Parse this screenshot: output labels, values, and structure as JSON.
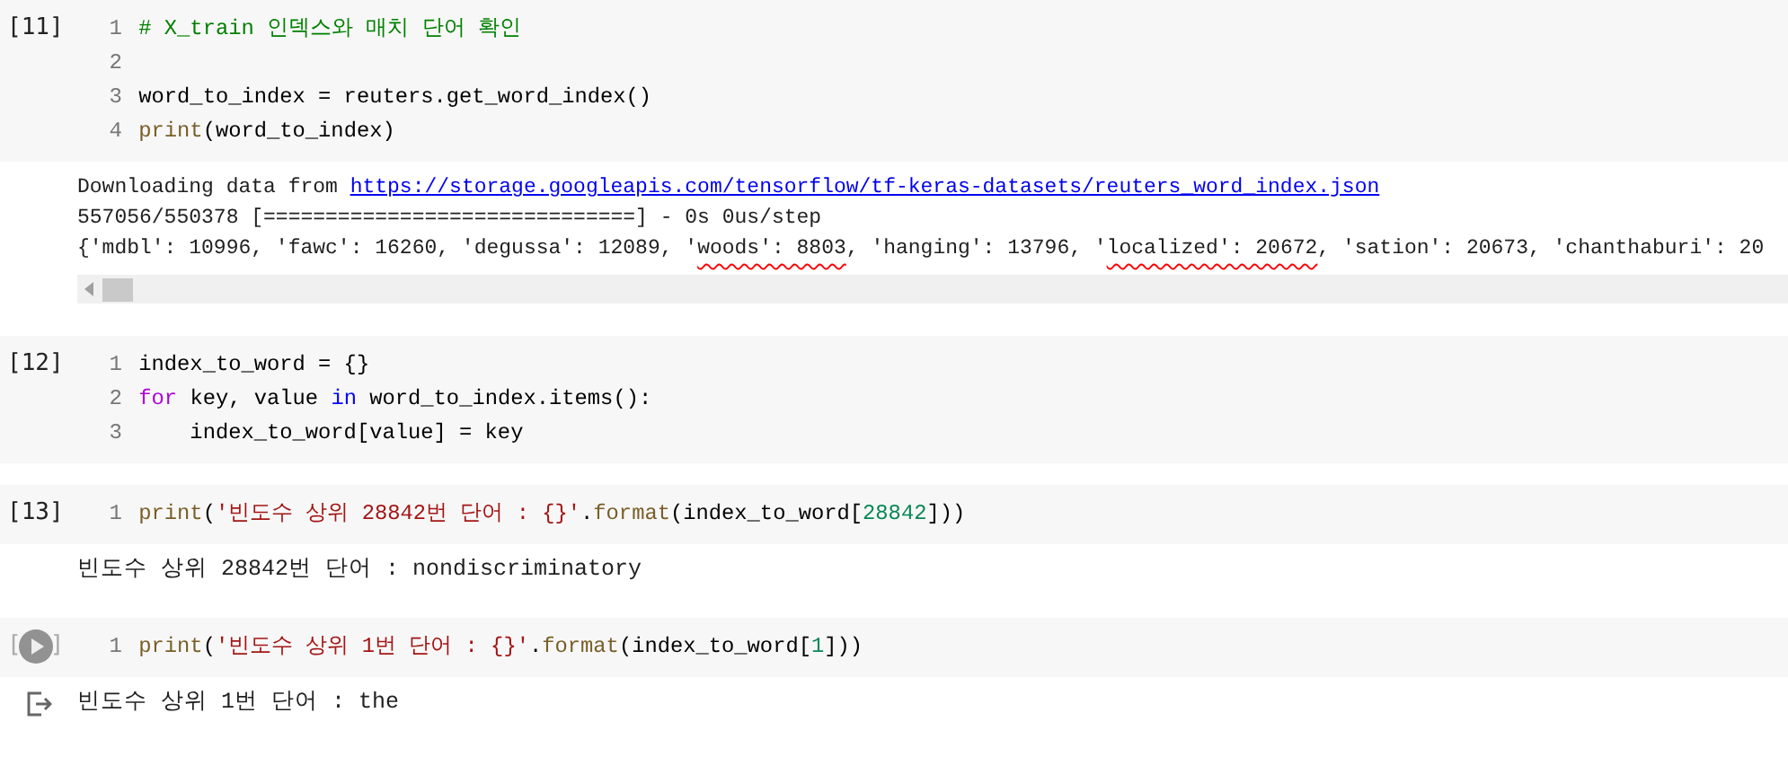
{
  "cells": [
    {
      "count": "[11]",
      "run_button": false,
      "lines": [
        {
          "no": "1",
          "tokens": [
            {
              "kind": "comment",
              "text": "# X_train 인덱스와 매치 단어 확인"
            }
          ]
        },
        {
          "no": "2"
        },
        {
          "no": "3",
          "tokens": [
            {
              "kind": "plain",
              "text": "word_to_index = reuters.get_word_index()"
            }
          ]
        },
        {
          "no": "4",
          "tokens": [
            {
              "kind": "builtin",
              "text": "print"
            },
            {
              "kind": "plain",
              "text": "(word_to_index)"
            }
          ]
        }
      ],
      "output": {
        "kind": "plain",
        "scrollbar": true,
        "lines": [
          [
            {
              "kind": "plain",
              "text": "Downloading data from "
            },
            {
              "kind": "link",
              "text": "https://storage.googleapis.com/tensorflow/tf-keras-datasets/reuters_word_index.json"
            }
          ],
          [
            {
              "kind": "plain",
              "text": "557056/550378 [==============================] - 0s 0us/step"
            }
          ],
          [
            {
              "kind": "plain",
              "text": "{'mdbl': 10996, 'fawc': 16260, 'degussa': 12089, '"
            },
            {
              "kind": "marked",
              "text": "woods': 8803"
            },
            {
              "kind": "plain",
              "text": ", 'hanging': 13796, '"
            },
            {
              "kind": "marked",
              "text": "localized': 20672"
            },
            {
              "kind": "plain",
              "text": ", 'sation': 20673, 'chanthaburi': 20"
            }
          ]
        ]
      }
    },
    {
      "count": "[12]",
      "run_button": false,
      "lines": [
        {
          "no": "1",
          "tokens": [
            {
              "kind": "plain",
              "text": "index_to_word = {}"
            }
          ]
        },
        {
          "no": "2",
          "tokens": [
            {
              "kind": "keyword",
              "text": "for"
            },
            {
              "kind": "plain",
              "text": " key, value "
            },
            {
              "kind": "operator",
              "text": "in"
            },
            {
              "kind": "plain",
              "text": " word_to_index.items():"
            }
          ]
        },
        {
          "no": "3",
          "tokens": [
            {
              "kind": "plain",
              "text": "    index_to_word[value] = key"
            }
          ]
        }
      ]
    },
    {
      "count": "[13]",
      "run_button": false,
      "lines": [
        {
          "no": "1",
          "tokens": [
            {
              "kind": "builtin",
              "text": "print"
            },
            {
              "kind": "plain",
              "text": "("
            },
            {
              "kind": "string",
              "text": "'빈도수 상위 28842번 단어 : {}'"
            },
            {
              "kind": "plain",
              "text": "."
            },
            {
              "kind": "builtin",
              "text": "format"
            },
            {
              "kind": "plain",
              "text": "(index_to_word["
            },
            {
              "kind": "number",
              "text": "28842"
            },
            {
              "kind": "plain",
              "text": "]))"
            }
          ]
        }
      ],
      "output": {
        "kind": "plain",
        "scrollbar": false,
        "lines": [
          [
            {
              "kind": "plain",
              "text": "빈도수 상위 28842번 단어 : nondiscriminatory"
            }
          ]
        ]
      }
    },
    {
      "count_open": "[",
      "count_close": "]",
      "run_button": true,
      "lines": [
        {
          "no": "1",
          "tokens": [
            {
              "kind": "builtin",
              "text": "print"
            },
            {
              "kind": "plain",
              "text": "("
            },
            {
              "kind": "string",
              "text": "'빈도수 상위 1번 단어 : {}'"
            },
            {
              "kind": "plain",
              "text": "."
            },
            {
              "kind": "builtin",
              "text": "format"
            },
            {
              "kind": "plain",
              "text": "(index_to_word["
            },
            {
              "kind": "number",
              "text": "1"
            },
            {
              "kind": "plain",
              "text": "]))"
            }
          ]
        }
      ],
      "output": {
        "kind": "active",
        "scrollbar": false,
        "lines": [
          [
            {
              "kind": "plain",
              "text": "빈도수 상위 1번 단어 : the"
            }
          ]
        ]
      }
    }
  ]
}
